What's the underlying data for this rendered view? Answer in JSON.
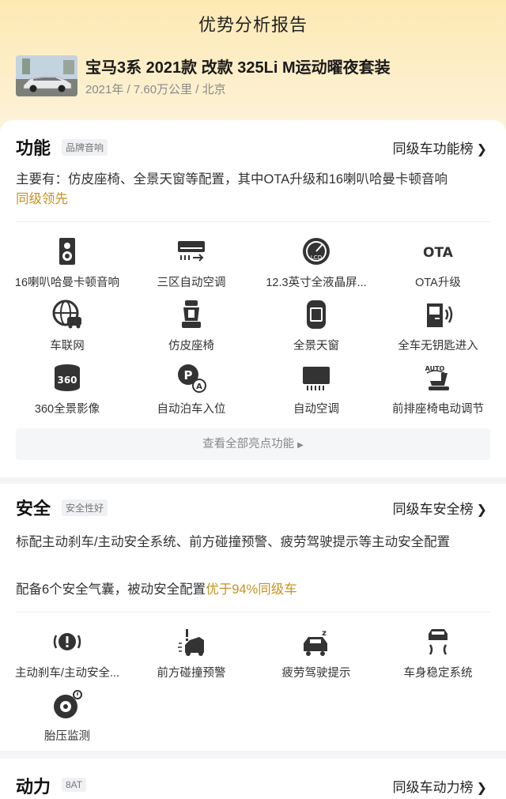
{
  "header": {
    "title": "优势分析报告",
    "car_title": "宝马3系 2021款 改款 325Li M运动曜夜套装",
    "car_meta": "2021年 / 7.60万公里 / 北京"
  },
  "function": {
    "title": "功能",
    "tag": "品牌音响",
    "link": "同级车功能榜",
    "desc_main": "主要有：仿皮座椅、全景天窗等配置，其中OTA升级和16喇叭哈曼卡顿音响",
    "desc_hl": "同级领先",
    "items": [
      {
        "label": "16喇叭哈曼卡顿音响",
        "icon": "speaker-icon"
      },
      {
        "label": "三区自动空调",
        "icon": "air-conditioner-icon"
      },
      {
        "label": "12.3英寸全液晶屏...",
        "icon": "lcd-gauge-icon"
      },
      {
        "label": "OTA升级",
        "icon": "ota-icon"
      },
      {
        "label": "车联网",
        "icon": "globe-car-icon"
      },
      {
        "label": "仿皮座椅",
        "icon": "seat-icon"
      },
      {
        "label": "全景天窗",
        "icon": "sunroof-icon"
      },
      {
        "label": "全车无钥匙进入",
        "icon": "keyless-door-icon"
      },
      {
        "label": "360全景影像",
        "icon": "camera-360-icon"
      },
      {
        "label": "自动泊车入位",
        "icon": "auto-parking-icon"
      },
      {
        "label": "自动空调",
        "icon": "auto-ac-icon"
      },
      {
        "label": "前排座椅电动调节",
        "icon": "seat-auto-icon"
      }
    ],
    "more": "查看全部亮点功能"
  },
  "safety": {
    "title": "安全",
    "tag": "安全性好",
    "link": "同级车安全榜",
    "desc1": "标配主动刹车/主动安全系统、前方碰撞预警、疲劳驾驶提示等主动安全配置",
    "desc2_main": "配备6个安全气囊，被动安全配置",
    "desc2_hl": "优于94%同级车",
    "items": [
      {
        "label": "主动刹车/主动安全...",
        "icon": "brake-warning-icon"
      },
      {
        "label": "前方碰撞预警",
        "icon": "collision-warning-icon"
      },
      {
        "label": "疲劳驾驶提示",
        "icon": "fatigue-icon"
      },
      {
        "label": "车身稳定系统",
        "icon": "stability-icon"
      },
      {
        "label": "胎压监测",
        "icon": "tire-pressure-icon"
      }
    ]
  },
  "power": {
    "title": "动力",
    "tag": "8AT",
    "link": "同级车动力榜"
  },
  "colors": {
    "highlight": "#c69322",
    "hero_top": "#fde9b3",
    "icon": "#333333"
  }
}
